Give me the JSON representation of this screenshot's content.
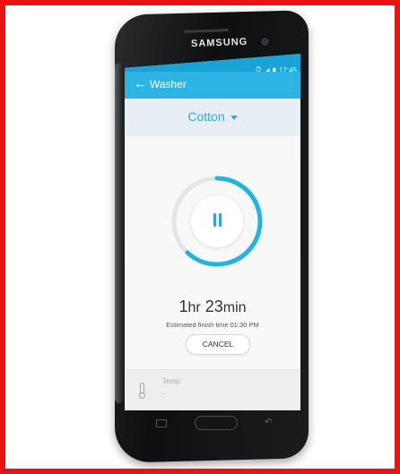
{
  "device": {
    "brand": "SAMSUNG"
  },
  "status_bar": {
    "time": "12:45"
  },
  "app_bar": {
    "title": "Washer"
  },
  "mode": {
    "selected": "Cotton"
  },
  "timer": {
    "hours": "1",
    "hours_unit": "hr",
    "minutes": "23",
    "minutes_unit": "min",
    "progress_fraction": 0.62,
    "finish_label": "Estimated finish time",
    "finish_time": "01:30 PM"
  },
  "actions": {
    "cancel_label": "CANCEL"
  },
  "temp": {
    "label": "Temp",
    "value": "-"
  },
  "colors": {
    "accent": "#2eb4e4",
    "ring": "#1eb5e3",
    "frame": "#ee1111"
  },
  "icons": {
    "back": "arrow-left-icon",
    "mode_caret": "caret-down-icon",
    "pause": "pause-icon",
    "temp": "thermometer-icon",
    "recent": "recent-apps-icon",
    "nav_back": "back-key-icon"
  }
}
